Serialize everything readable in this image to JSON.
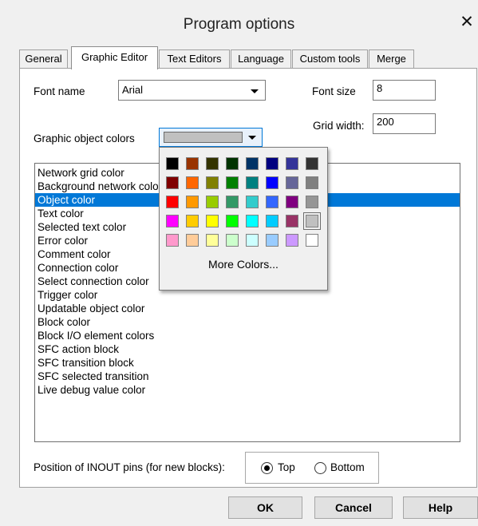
{
  "window": {
    "title": "Program options",
    "close_symbol": "✕"
  },
  "tabs": [
    {
      "label": "General",
      "active": false
    },
    {
      "label": "Graphic Editor",
      "active": true
    },
    {
      "label": "Text Editors",
      "active": false
    },
    {
      "label": "Language",
      "active": false
    },
    {
      "label": "Custom tools",
      "active": false
    },
    {
      "label": "Merge",
      "active": false
    }
  ],
  "font": {
    "name_label": "Font name",
    "name_value": "Arial",
    "size_label": "Font size",
    "size_value": "8"
  },
  "grid": {
    "width_label": "Grid width:",
    "width_value": "200"
  },
  "object_colors": {
    "label": "Graphic object colors",
    "selected_color": "#c0c0c0"
  },
  "color_list": {
    "items": [
      "Network grid color",
      "Background network color",
      "Object color",
      "Text color",
      "Selected text color",
      "Error color",
      "Comment color",
      "Connection color",
      "Select connection color",
      "Trigger color",
      "Updatable object color",
      "Block color",
      "Block I/O element colors",
      "SFC action block",
      "SFC transition block",
      "SFC selected transition",
      "Live debug value color"
    ],
    "selected_index": 2
  },
  "palette": {
    "rows": [
      [
        "#000000",
        "#993300",
        "#333300",
        "#003300",
        "#003366",
        "#000080",
        "#333399",
        "#333333"
      ],
      [
        "#800000",
        "#ff6600",
        "#808000",
        "#008000",
        "#008080",
        "#0000ff",
        "#666699",
        "#808080"
      ],
      [
        "#ff0000",
        "#ff9900",
        "#99cc00",
        "#339966",
        "#33cccc",
        "#3366ff",
        "#800080",
        "#969696"
      ],
      [
        "#ff00ff",
        "#ffcc00",
        "#ffff00",
        "#00ff00",
        "#00ffff",
        "#00ccff",
        "#993366",
        "#c0c0c0"
      ],
      [
        "#ff99cc",
        "#ffcc99",
        "#ffff99",
        "#ccffcc",
        "#ccffff",
        "#99ccff",
        "#cc99ff",
        "#ffffff"
      ]
    ],
    "selected": [
      3,
      7
    ],
    "more_label": "More Colors..."
  },
  "inout": {
    "label": "Position of INOUT pins (for new blocks):",
    "options": [
      "Top",
      "Bottom"
    ],
    "selected_index": 0
  },
  "buttons": {
    "ok": "OK",
    "cancel": "Cancel",
    "help": "Help"
  }
}
